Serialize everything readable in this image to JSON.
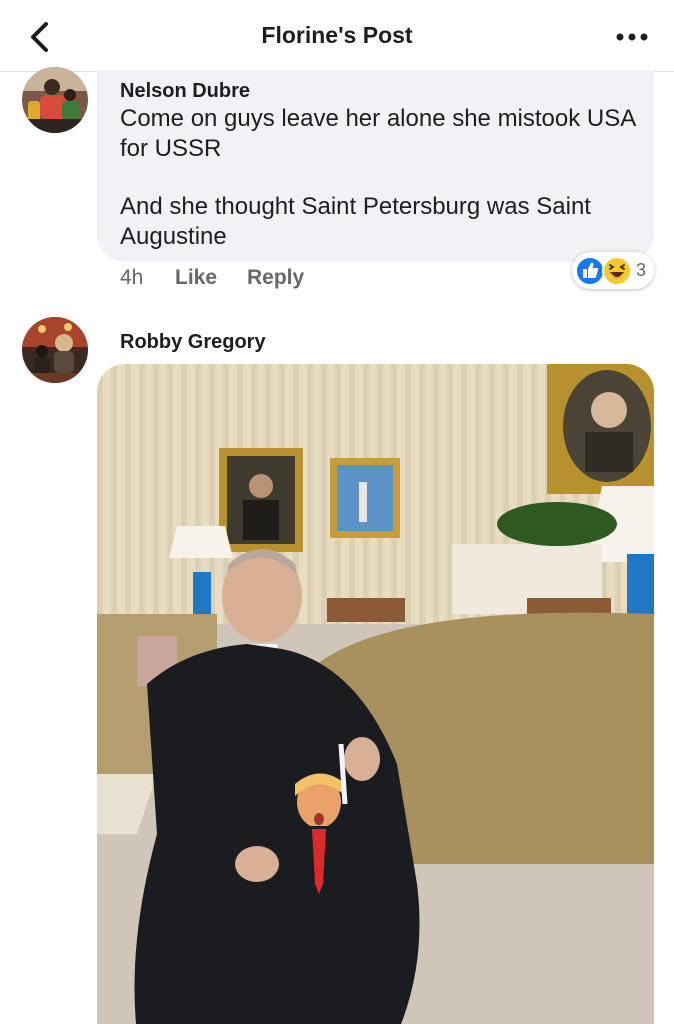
{
  "header": {
    "title": "Florine's Post",
    "back_icon": "chevron-left-icon",
    "more_icon": "more-dots-icon"
  },
  "comments": [
    {
      "author": "Nelson Dubre",
      "text_line1": "Come on guys leave her alone she mistook USA for USSR",
      "text_line2": "And she thought Saint Petersburg was Saint Augustine",
      "time": "4h",
      "like_label": "Like",
      "reply_label": "Reply",
      "reaction_count": "3",
      "reaction_icons": [
        "like-reaction-icon",
        "haha-reaction-icon"
      ]
    },
    {
      "author": "Robby Gregory",
      "attachment": "image"
    }
  ],
  "colors": {
    "bubble": "#f0f2f5",
    "meta_text": "#65676b",
    "like_blue": "#1877f2",
    "haha_yellow": "#f7c930"
  }
}
